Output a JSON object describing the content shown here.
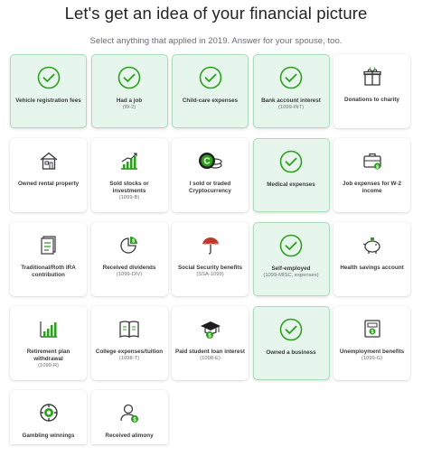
{
  "header": {
    "title": "Let's get an idea of your financial picture",
    "subtitle": "Select anything that applied in 2019. Answer for your spouse, too."
  },
  "colors": {
    "accent": "#2ca01c",
    "selected_bg": "#e7f6ec",
    "selected_border": "#a9dcb8"
  },
  "cards": [
    {
      "label": "Vehicle registration fees",
      "sub": "",
      "icon": "check-circle-icon",
      "selected": true
    },
    {
      "label": "Had a job",
      "sub": "(W-2)",
      "icon": "check-circle-icon",
      "selected": true
    },
    {
      "label": "Child-care expenses",
      "sub": "",
      "icon": "check-circle-icon",
      "selected": true
    },
    {
      "label": "Bank account interest",
      "sub": "(1099-INT)",
      "icon": "check-circle-icon",
      "selected": true
    },
    {
      "label": "Donations to charity",
      "sub": "",
      "icon": "gift-icon",
      "selected": false
    },
    {
      "label": "Owned rental property",
      "sub": "",
      "icon": "house-icon",
      "selected": false
    },
    {
      "label": "Sold stocks or investments",
      "sub": "(1099-B)",
      "icon": "growth-chart-icon",
      "selected": false
    },
    {
      "label": "I sold or traded Cryptocurrency",
      "sub": "",
      "icon": "crypto-coins-icon",
      "selected": false
    },
    {
      "label": "Medical expenses",
      "sub": "",
      "icon": "check-circle-icon",
      "selected": true
    },
    {
      "label": "Job expenses for W-2 income",
      "sub": "",
      "icon": "briefcase-icon",
      "selected": false
    },
    {
      "label": "Traditional/Roth IRA contribution",
      "sub": "",
      "icon": "documents-icon",
      "selected": false
    },
    {
      "label": "Received dividends",
      "sub": "(1099-DIV)",
      "icon": "pie-chart-icon",
      "selected": false
    },
    {
      "label": "Social Security benefits",
      "sub": "(SSA-1099)",
      "icon": "umbrella-icon",
      "selected": false
    },
    {
      "label": "Self-employed",
      "sub": "(1099-MISC, expenses)",
      "icon": "check-circle-icon",
      "selected": true
    },
    {
      "label": "Health savings account",
      "sub": "",
      "icon": "piggy-bank-icon",
      "selected": false
    },
    {
      "label": "Retirement plan withdrawal",
      "sub": "(1099-R)",
      "icon": "bar-chart-icon",
      "selected": false
    },
    {
      "label": "College expenses/tuition",
      "sub": "(1098-T)",
      "icon": "book-icon",
      "selected": false
    },
    {
      "label": "Paid student loan interest",
      "sub": "(1098-E)",
      "icon": "graduation-cap-icon",
      "selected": false
    },
    {
      "label": "Owned a business",
      "sub": "",
      "icon": "check-circle-icon",
      "selected": true
    },
    {
      "label": "Unemployment benefits",
      "sub": "(1099-G)",
      "icon": "register-icon",
      "selected": false
    },
    {
      "label": "Gambling winnings",
      "sub": "",
      "icon": "poker-chip-icon",
      "selected": false
    },
    {
      "label": "Received alimony",
      "sub": "",
      "icon": "person-dollar-icon",
      "selected": false
    }
  ]
}
